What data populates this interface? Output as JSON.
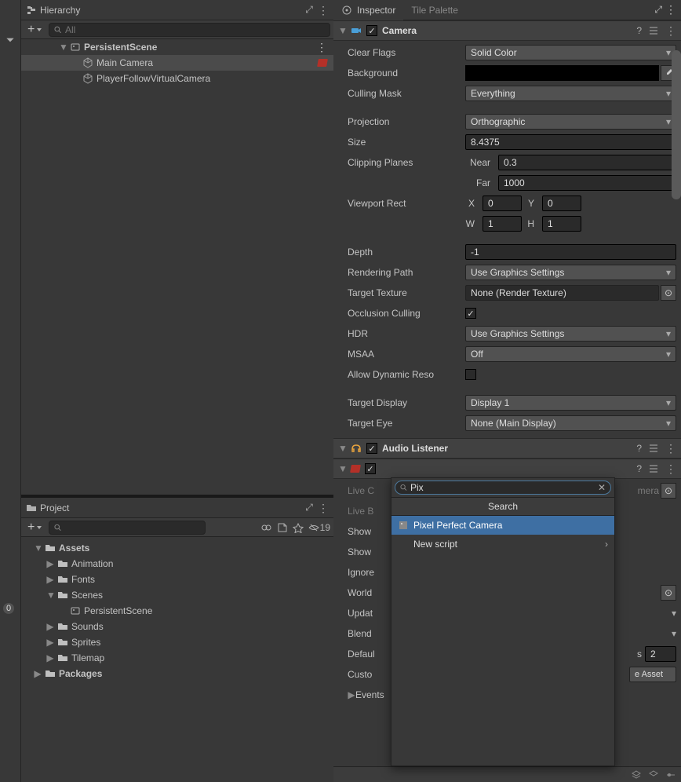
{
  "hierarchy": {
    "title": "Hierarchy",
    "search_placeholder": "All",
    "items": {
      "scene": "PersistentScene",
      "main_camera": "Main Camera",
      "virtual_camera": "PlayerFollowVirtualCamera"
    }
  },
  "project": {
    "title": "Project",
    "hidden_count": "19",
    "root": "Assets",
    "folders": [
      "Animation",
      "Fonts",
      "Scenes",
      "Sounds",
      "Sprites",
      "Tilemap"
    ],
    "scene_asset": "PersistentScene",
    "packages": "Packages"
  },
  "left_gutter_badge": "0",
  "inspector": {
    "tab_inspector": "Inspector",
    "tab_tilepalette": "Tile Palette",
    "camera": {
      "title": "Camera",
      "clear_flags": {
        "label": "Clear Flags",
        "value": "Solid Color"
      },
      "background": {
        "label": "Background"
      },
      "culling_mask": {
        "label": "Culling Mask",
        "value": "Everything"
      },
      "projection": {
        "label": "Projection",
        "value": "Orthographic"
      },
      "size": {
        "label": "Size",
        "value": "8.4375"
      },
      "clipping": {
        "label": "Clipping Planes",
        "near_label": "Near",
        "near": "0.3",
        "far_label": "Far",
        "far": "1000"
      },
      "viewport": {
        "label": "Viewport Rect",
        "x": "0",
        "y": "0",
        "w": "1",
        "h": "1"
      },
      "depth": {
        "label": "Depth",
        "value": "-1"
      },
      "rendering_path": {
        "label": "Rendering Path",
        "value": "Use Graphics Settings"
      },
      "target_texture": {
        "label": "Target Texture",
        "value": "None (Render Texture)"
      },
      "occlusion": {
        "label": "Occlusion Culling"
      },
      "hdr": {
        "label": "HDR",
        "value": "Use Graphics Settings"
      },
      "msaa": {
        "label": "MSAA",
        "value": "Off"
      },
      "dynamic_res": {
        "label": "Allow Dynamic Reso"
      },
      "target_display": {
        "label": "Target Display",
        "value": "Display 1"
      },
      "target_eye": {
        "label": "Target Eye",
        "value": "None (Main Display)"
      }
    },
    "audio_listener": {
      "title": "Audio Listener"
    },
    "cinemachine": {
      "live_camera_label": "Live C",
      "live_camera_suffix": "mera",
      "live_blend_label": "Live B",
      "show1": "Show",
      "show2": "Show",
      "ignore": "Ignore",
      "world": "World",
      "update": "Updat",
      "blend": "Blend",
      "default": "Defaul",
      "default_s": "s",
      "default_val": "2",
      "custom": "Custo",
      "custom_suffix": "e Asset",
      "events": "Events"
    }
  },
  "popup": {
    "search_value": "Pix",
    "title": "Search",
    "item1": "Pixel Perfect Camera",
    "item2": "New script"
  }
}
